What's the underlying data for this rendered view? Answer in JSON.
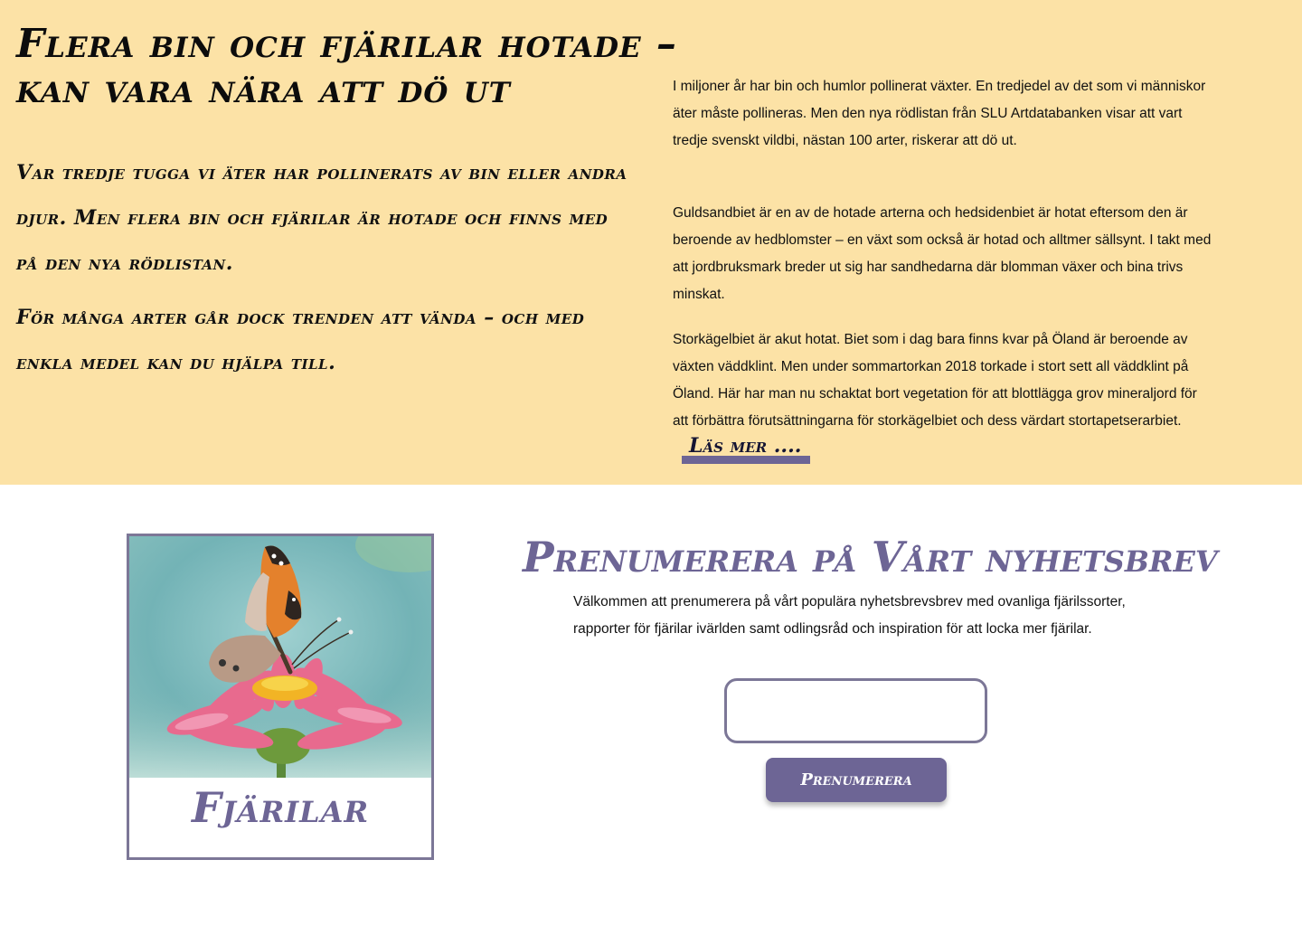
{
  "hero": {
    "title": "Flera bin och fjärilar hotade – kan vara nära att dö ut",
    "lead_1": "Var tredje tugga vi äter har pollinerats av bin eller andra djur. Men flera bin och fjärilar är hotade och finns med på den nya rödlistan.",
    "lead_2": "För många arter går dock trenden att vända – och med enkla medel kan du hjälpa till.",
    "paragraph_1": "I miljoner år har bin och humlor pollinerat växter. En tredjedel av det som vi människor äter måste pollineras. Men den nya rödlistan från SLU Artdatabanken visar att vart tredje svenskt vildbi, nästan 100 arter, riskerar att dö ut.",
    "paragraph_2": "Guldsandbiet är en av de hotade arterna och hedsidenbiet är hotat eftersom den är beroende av hedblomster – en växt som också är hotad och alltmer sällsynt. I takt med att jordbruksmark breder ut sig har sandhedarna där blomman växer och bina trivs minskat.",
    "paragraph_3": "Storkägelbiet är akut hotat. Biet som i dag bara finns kvar på Öland är beroende av växten väddklint. Men under sommartorkan 2018 torkade i stort sett all väddklint på Öland. Här har man nu schaktat bort vegetation för att blottlägga grov mineraljord för att förbättra förutsättningarna för storkägelbiet och dess värdart stortapetserarbiet.",
    "read_more": "Läs mer ...."
  },
  "card": {
    "label": "Fjärilar"
  },
  "newsletter": {
    "title": "Prenumerera på Vårt nyhetsbrev",
    "text": "Välkommen att prenumerera på vårt populära nyhetsbrevsbrev med ovanliga fjärilssorter, rapporter för fjärilar ivärlden samt odlingsråd och inspiration för att locka mer fjärilar.",
    "email_value": "",
    "button_label": "Prenumerera"
  },
  "colors": {
    "hero_background": "#fce2a6",
    "accent_purple": "#6d6595",
    "border_purple": "#7c7797"
  }
}
